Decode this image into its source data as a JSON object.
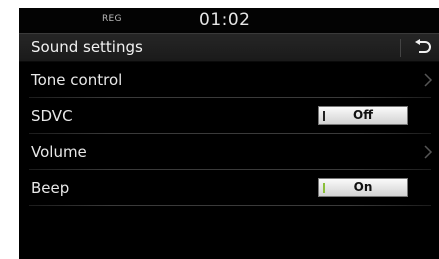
{
  "status_bar": {
    "reg_label": "REG",
    "time": "01:02"
  },
  "header": {
    "title": "Sound settings",
    "back_icon": "back-arrow-icon"
  },
  "settings": {
    "items": [
      {
        "label": "Tone control",
        "control": "chevron"
      },
      {
        "label": "SDVC",
        "control": "toggle",
        "value": "Off"
      },
      {
        "label": "Volume",
        "control": "chevron"
      },
      {
        "label": "Beep",
        "control": "toggle",
        "value": "On"
      }
    ]
  },
  "colors": {
    "background": "#000000",
    "header": "#222222",
    "text": "#e8e8e8",
    "toggle_on_indicator": "#8bbf3a",
    "toggle_off_indicator": "#222222"
  }
}
